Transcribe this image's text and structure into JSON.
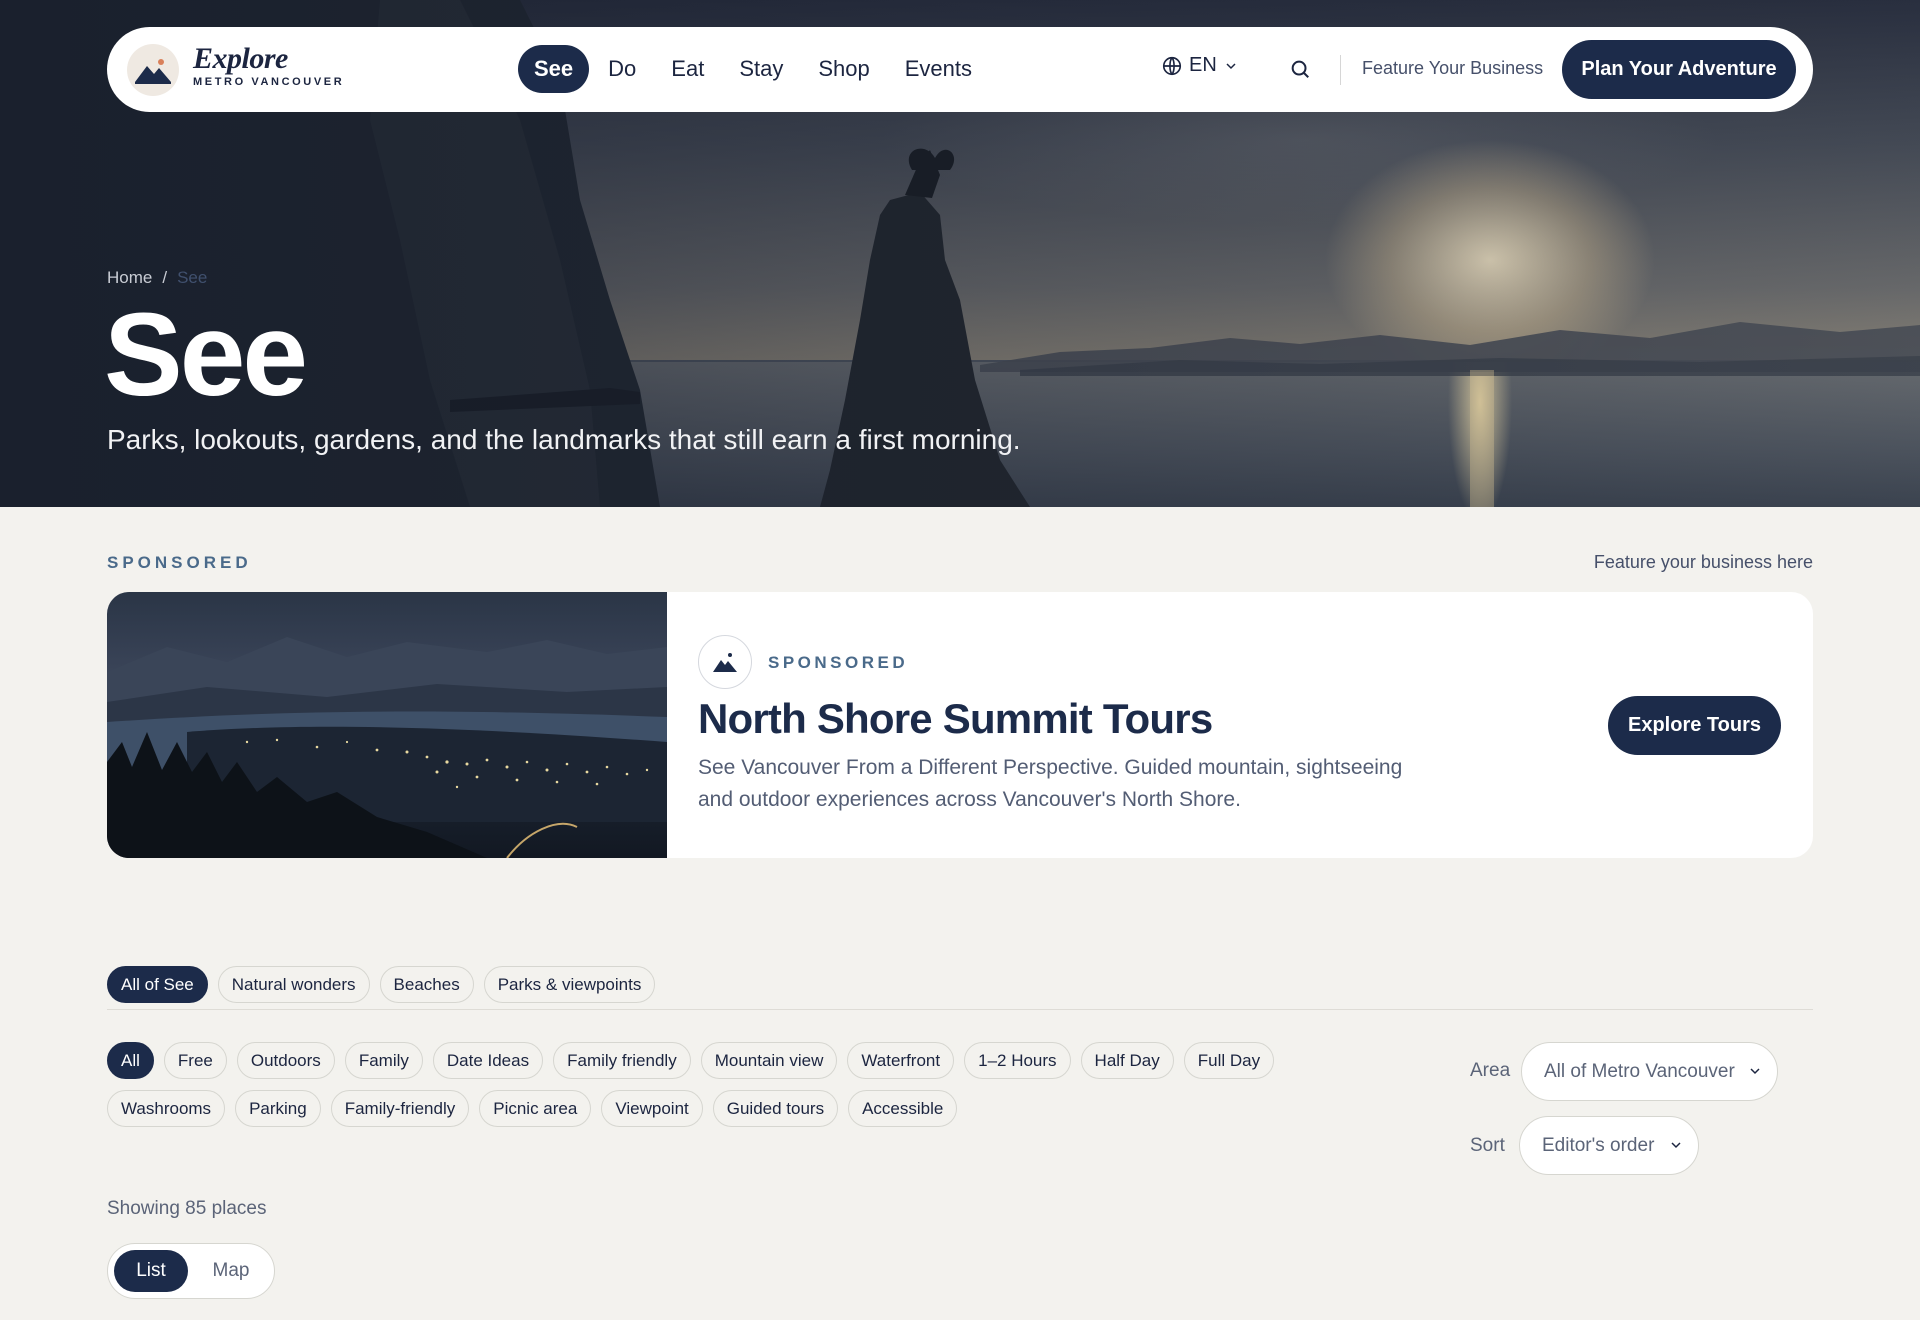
{
  "nav": {
    "logo_title": "Explore",
    "logo_subtitle": "METRO VANCOUVER",
    "links": [
      "See",
      "Do",
      "Eat",
      "Stay",
      "Shop",
      "Events"
    ],
    "active_link": "See",
    "language": "EN",
    "feature_link": "Feature Your Business",
    "cta": "Plan Your Adventure"
  },
  "hero": {
    "breadcrumb": [
      "Home",
      "See"
    ],
    "breadcrumb_separator": "/",
    "title": "See",
    "subtitle": "Parks, lookouts, gardens, and the landmarks that still earn a first morning."
  },
  "sponsored": {
    "section_label": "SPONSORED",
    "feature_link": "Feature your business here",
    "tag": "SPONSORED",
    "title": "North Shore Summit Tours",
    "description": "See Vancouver From a Different Perspective. Guided mountain, sightseeing and outdoor experiences across Vancouver's North Shore.",
    "button": "Explore Tours"
  },
  "filters": {
    "category_tabs": [
      "All of See",
      "Natural wonders",
      "Beaches",
      "Parks & viewpoints"
    ],
    "active_category": "All of See",
    "tags_row1": [
      "All",
      "Free",
      "Outdoors",
      "Family",
      "Date Ideas",
      "Family friendly",
      "Mountain view",
      "Waterfront",
      "1–2 Hours",
      "Half Day",
      "Full Day"
    ],
    "tags_row2": [
      "Washrooms",
      "Parking",
      "Family-friendly",
      "Picnic area",
      "Viewpoint",
      "Guided tours",
      "Accessible"
    ],
    "active_tag": "All",
    "area_label": "Area",
    "area_value": "All of Metro Vancouver",
    "sort_label": "Sort",
    "sort_value": "Editor's order"
  },
  "results": {
    "showing": "Showing 85 places",
    "view_list": "List",
    "view_map": "Map",
    "active_view": "List"
  },
  "colors": {
    "navy": "#1c2b4a",
    "page_bg": "#f3f2ee",
    "accent_label": "#4a6a8a"
  }
}
